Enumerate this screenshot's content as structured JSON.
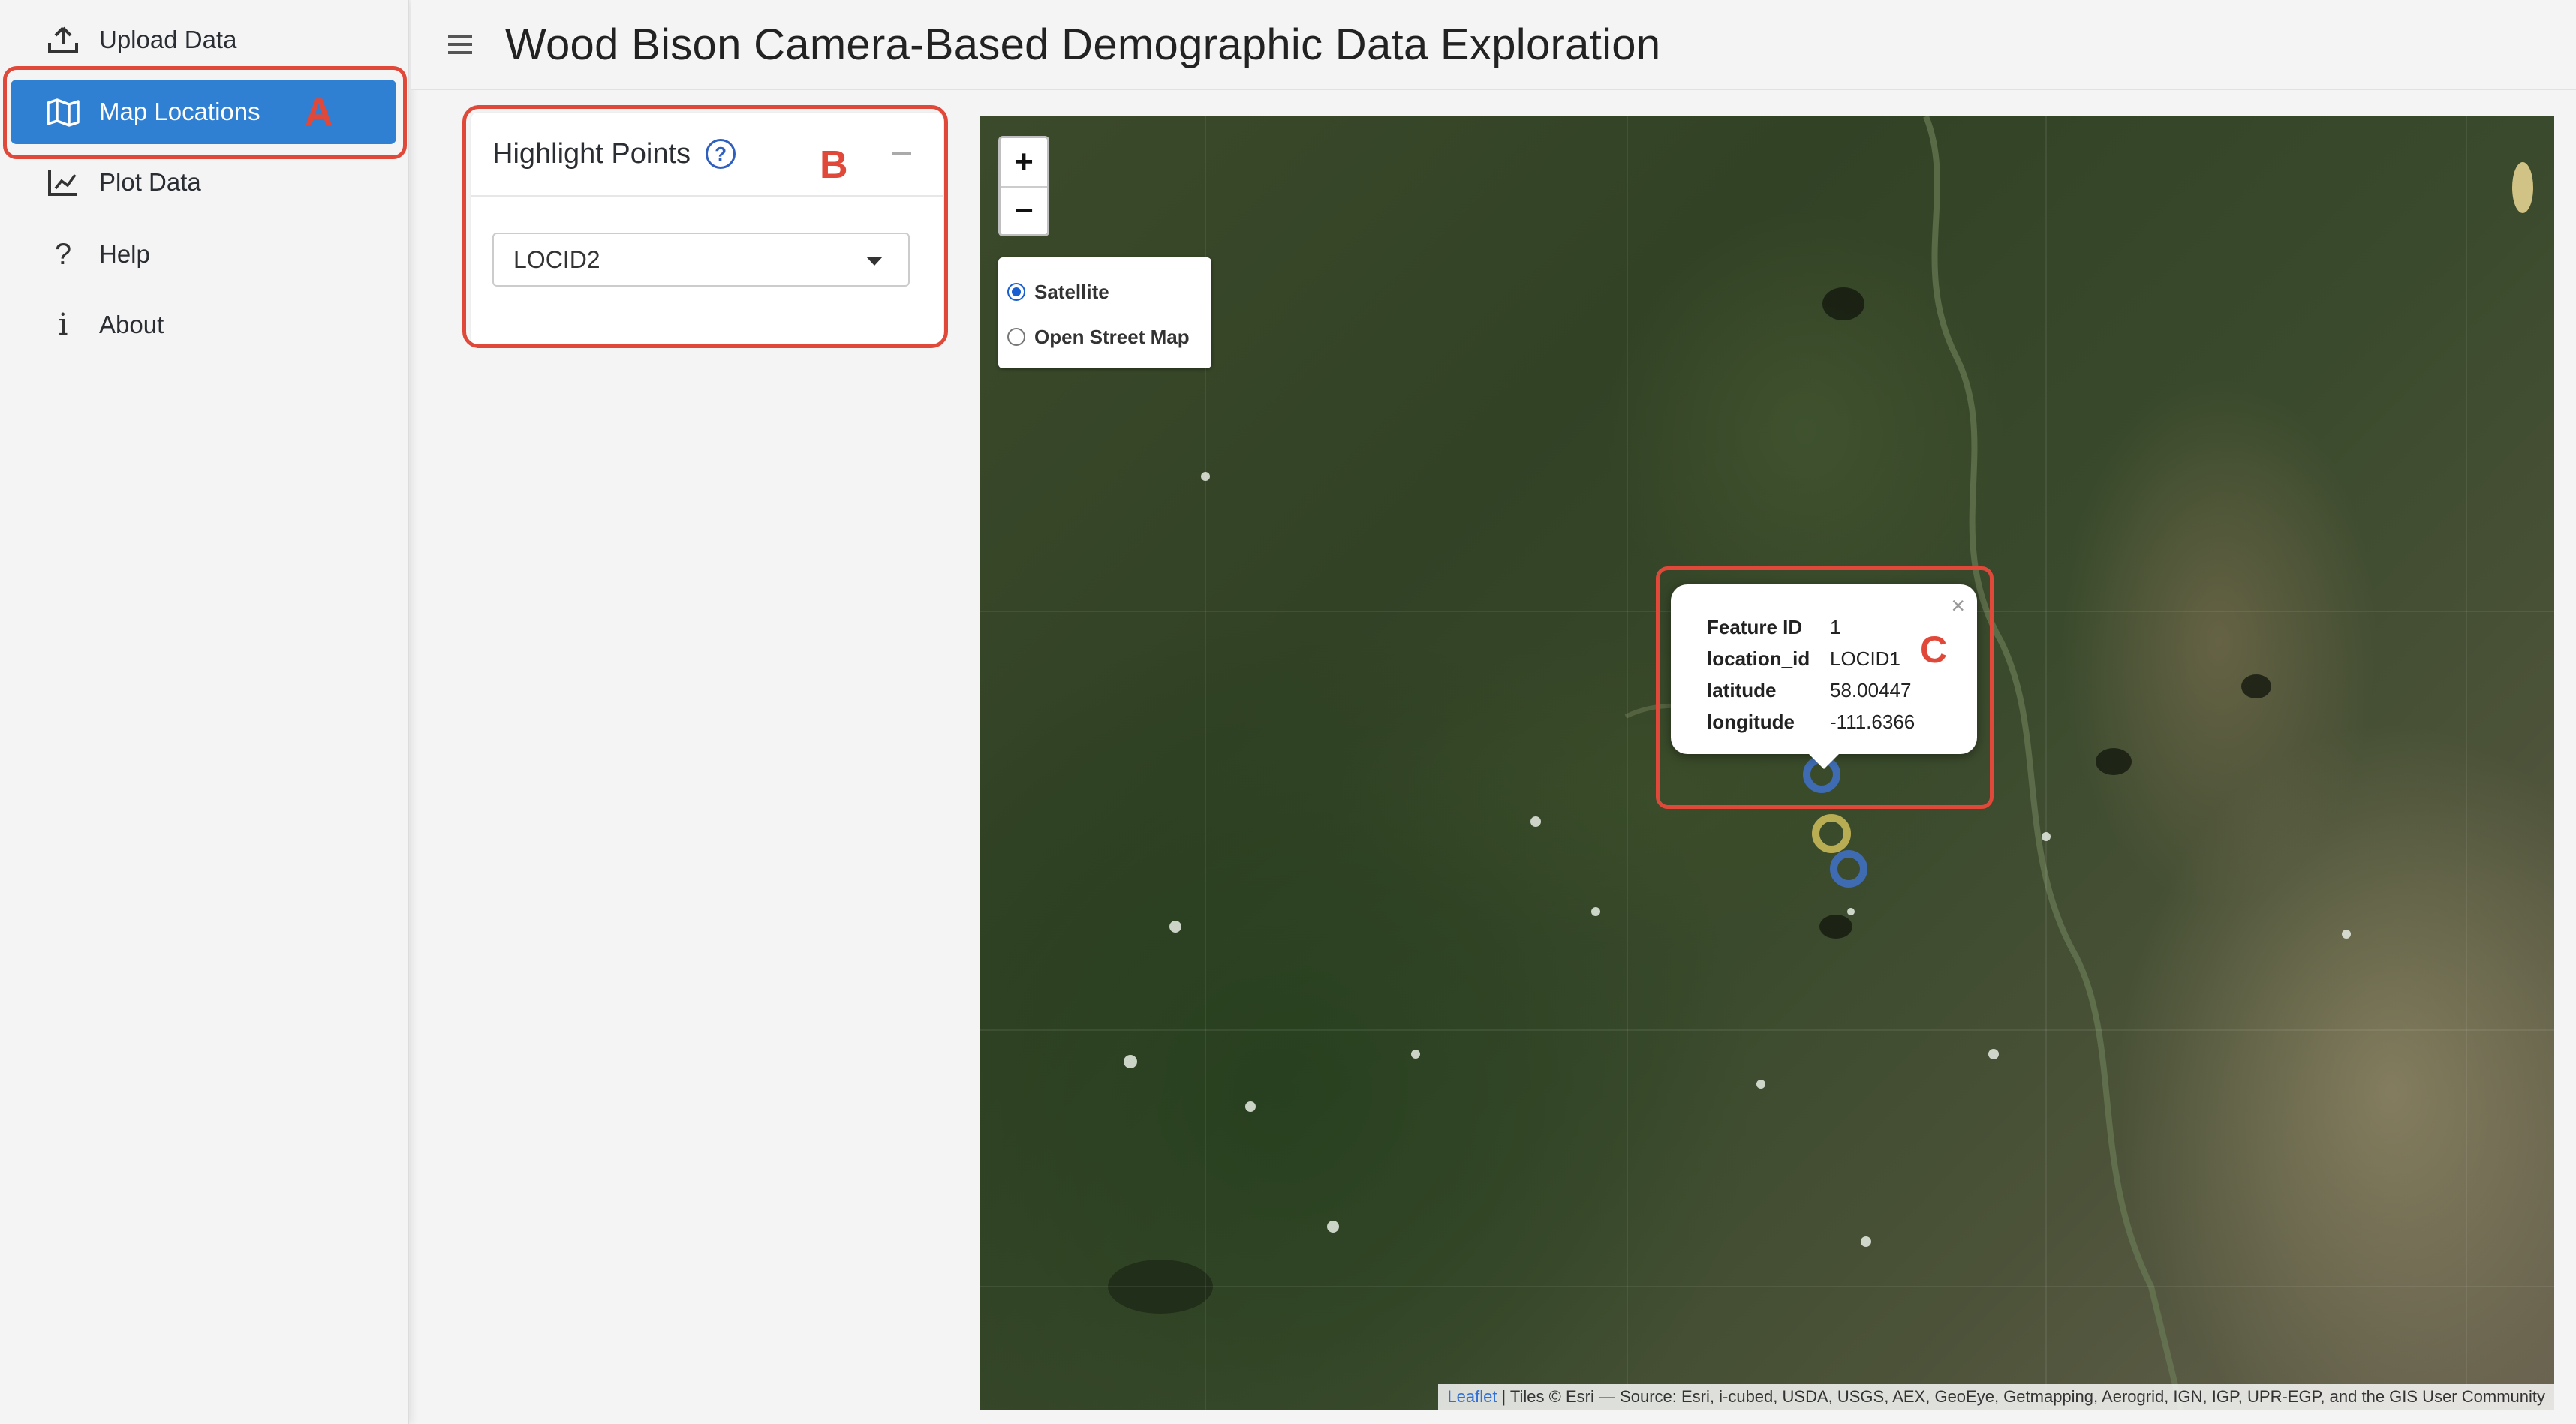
{
  "sidebar": {
    "items": [
      {
        "label": "Upload Data",
        "icon": "upload-icon"
      },
      {
        "label": "Map Locations",
        "icon": "map-icon",
        "tag": "A"
      },
      {
        "label": "Plot Data",
        "icon": "chart-icon"
      },
      {
        "label": "Help",
        "icon": "question-icon"
      },
      {
        "label": "About",
        "icon": "info-icon"
      }
    ]
  },
  "header": {
    "title": "Wood Bison Camera-Based Demographic Data Exploration"
  },
  "highlight": {
    "title": "Highlight Points",
    "tag": "B",
    "selected": "LOCID2"
  },
  "map": {
    "zoom_in": "+",
    "zoom_out": "−",
    "layers": [
      "Satellite",
      "Open Street Map"
    ],
    "selected_layer": "Satellite",
    "popup": {
      "rows": [
        {
          "key": "Feature ID",
          "value": "1"
        },
        {
          "key": "location_id",
          "value": "LOCID1"
        },
        {
          "key": "latitude",
          "value": "58.00447"
        },
        {
          "key": "longitude",
          "value": "-111.6366"
        }
      ],
      "tag": "C",
      "close": "×"
    },
    "attribution": {
      "link": "Leaflet",
      "text": "| Tiles © Esri — Source: Esri, i-cubed, USDA, USGS, AEX, GeoEye, Getmapping, Aerogrid, IGN, IGP, UPR-EGP, and the GIS User Community"
    }
  },
  "colors": {
    "accent": "#2f7fd3",
    "annotation": "#e0493a",
    "marker_blue": "#3f6fc0",
    "marker_yellow": "#c8b858"
  }
}
